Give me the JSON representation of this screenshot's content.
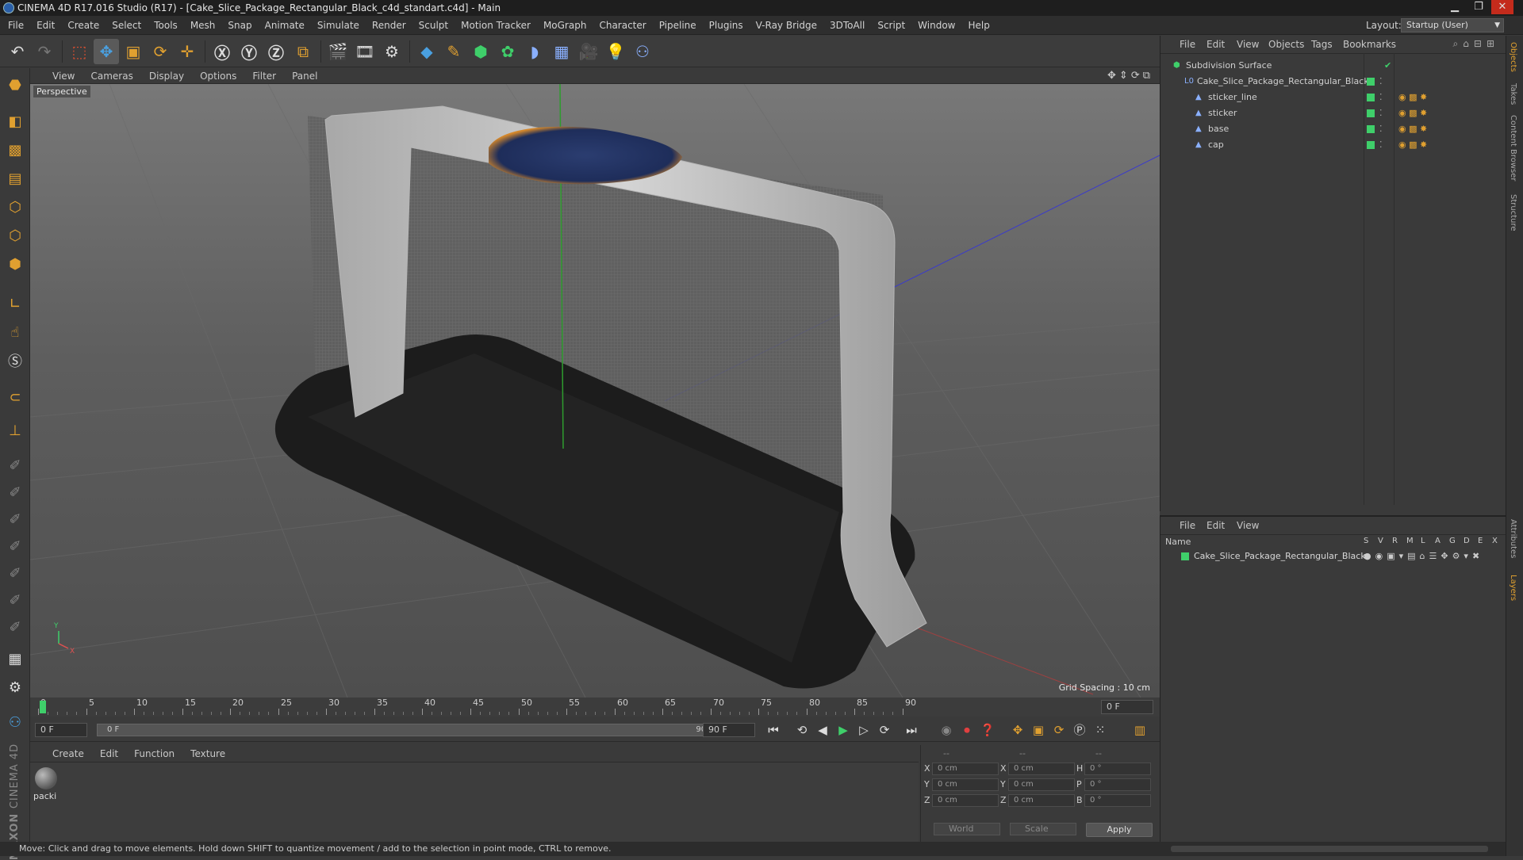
{
  "window": {
    "title": "CINEMA 4D R17.016 Studio (R17) - [Cake_Slice_Package_Rectangular_Black_c4d_standart.c4d] - Main"
  },
  "menubar": {
    "items": [
      "File",
      "Edit",
      "Create",
      "Select",
      "Tools",
      "Mesh",
      "Snap",
      "Animate",
      "Simulate",
      "Render",
      "Sculpt",
      "Motion Tracker",
      "MoGraph",
      "Character",
      "Pipeline",
      "Plugins",
      "V-Ray Bridge",
      "3DToAll",
      "Script",
      "Window",
      "Help"
    ],
    "layout_label": "Layout:",
    "layout_value": "Startup (User)"
  },
  "viewport": {
    "menu": [
      "View",
      "Cameras",
      "Display",
      "Options",
      "Filter",
      "Panel"
    ],
    "label": "Perspective",
    "grid_spacing": "Grid Spacing : 10 cm",
    "axis_x": "X",
    "axis_y": "Y"
  },
  "timeline": {
    "ticks": [
      "0",
      "5",
      "10",
      "15",
      "20",
      "25",
      "30",
      "35",
      "40",
      "45",
      "50",
      "55",
      "60",
      "65",
      "70",
      "75",
      "80",
      "85",
      "90"
    ],
    "current_frame": "0 F"
  },
  "transport": {
    "start_field": "0 F",
    "range_start": "0 F",
    "range_end": "90 F",
    "end_field": "90 F"
  },
  "material_manager": {
    "menu": [
      "Create",
      "Edit",
      "Function",
      "Texture"
    ],
    "material_name": "packi"
  },
  "coordinates": {
    "headers": [
      "--",
      "--",
      "--"
    ],
    "rows": [
      {
        "l1": "X",
        "v1": "0 cm",
        "l2": "X",
        "v2": "0 cm",
        "l3": "H",
        "v3": "0 °"
      },
      {
        "l1": "Y",
        "v1": "0 cm",
        "l2": "Y",
        "v2": "0 cm",
        "l3": "P",
        "v3": "0 °"
      },
      {
        "l1": "Z",
        "v1": "0 cm",
        "l2": "Z",
        "v2": "0 cm",
        "l3": "B",
        "v3": "0 °"
      }
    ],
    "world_select": "World",
    "scale_select": "Scale",
    "apply_label": "Apply"
  },
  "status": {
    "text": "Move: Click and drag to move elements. Hold down SHIFT to quantize movement / add to the selection in point mode, CTRL to remove."
  },
  "object_manager": {
    "menu": [
      "File",
      "Edit",
      "View",
      "Objects",
      "Tags",
      "Bookmarks"
    ],
    "tree": [
      {
        "name": "Subdivision Surface",
        "level": 0
      },
      {
        "name": "Cake_Slice_Package_Rectangular_Black",
        "level": 1
      },
      {
        "name": "sticker_line",
        "level": 2
      },
      {
        "name": "sticker",
        "level": 2
      },
      {
        "name": "base",
        "level": 2
      },
      {
        "name": "cap",
        "level": 2
      }
    ]
  },
  "layer_manager": {
    "menu": [
      "File",
      "Edit",
      "View"
    ],
    "name_header": "Name",
    "col_headers": [
      "S",
      "V",
      "R",
      "M",
      "L",
      "A",
      "G",
      "D",
      "E",
      "X"
    ],
    "layer_name": "Cake_Slice_Package_Rectangular_Black"
  },
  "right_tabs": [
    "Objects",
    "Takes",
    "Content Browser",
    "Structure",
    "Attributes",
    "Layers"
  ],
  "colors": {
    "accent_orange": "#e0a030",
    "layer_green": "#3fcf6a",
    "sticker_blue": "#2b3d70",
    "sticker_orange": "#d98a2a"
  }
}
